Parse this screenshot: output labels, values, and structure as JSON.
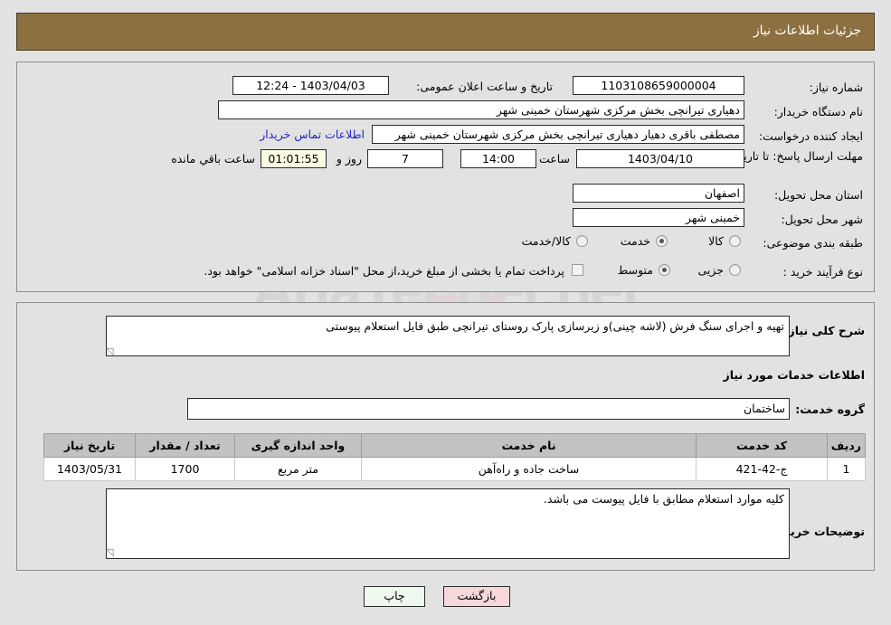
{
  "header": {
    "title": "جزئیات اطلاعات نیاز"
  },
  "watermark": {
    "text": "AriaTender.net"
  },
  "top_panel": {
    "need_number": {
      "label": "شماره نیاز:",
      "value": "1103108659000004"
    },
    "announce_datetime": {
      "label": "تاریخ و ساعت اعلان عمومی:",
      "value": "1403/04/03 - 12:24"
    },
    "buyer_org": {
      "label": "نام دستگاه خریدار:",
      "value": "دهیاری تیرانچی بخش مرکزی شهرستان خمینی شهر"
    },
    "requester": {
      "label": "ایجاد کننده درخواست:",
      "value": "مصطفی باقری دهیار  دهیاری تیرانچی بخش مرکزی شهرستان خمینی شهر"
    },
    "contact_link": "اطلاعات تماس خریدار",
    "deadline": {
      "label": "مهلت ارسال پاسخ: تا تاریخ:",
      "date": "1403/04/10",
      "time_label": "ساعت",
      "time": "14:00",
      "days": "7",
      "days_label": "روز و",
      "countdown": "01:01:55",
      "countdown_label": "ساعت باقي مانده"
    },
    "province": {
      "label": "استان محل تحویل:",
      "value": "اصفهان"
    },
    "city": {
      "label": "شهر محل تحویل:",
      "value": "خمینی شهر"
    },
    "category": {
      "label": "طبقه بندی موضوعی:",
      "options": [
        {
          "label": "کالا",
          "selected": false
        },
        {
          "label": "خدمت",
          "selected": true
        },
        {
          "label": "کالا/خدمت",
          "selected": false
        }
      ]
    },
    "purchase_type": {
      "label": "نوع فرآیند خرید :",
      "options": [
        {
          "label": "جزیی",
          "selected": false
        },
        {
          "label": "متوسط",
          "selected": true
        }
      ]
    },
    "treasury_checkbox": {
      "checked": false,
      "label": "پرداخت تمام یا بخشی از مبلغ خرید،از محل \"اسناد خزانه اسلامی\" خواهد بود."
    }
  },
  "bottom_panel": {
    "general_desc": {
      "label": "شرح کلی نیاز:",
      "value": "تهیه و اجرای سنگ فرش (لاشه چینی)و زیرسازی پارک روستای تیرانچی طبق فایل استعلام پیوستی"
    },
    "services_section_title": "اطلاعات خدمات مورد نیاز",
    "service_group": {
      "label": "گروه خدمت:",
      "value": "ساختمان"
    },
    "table": {
      "headers": [
        "ردیف",
        "کد خدمت",
        "نام خدمت",
        "واحد اندازه گیری",
        "تعداد / مقدار",
        "تاریخ نیاز"
      ],
      "rows": [
        {
          "row": "1",
          "code": "ج-42-421",
          "name": "ساخت جاده و راه‌آهن",
          "unit": "متر مربع",
          "qty": "1700",
          "need_date": "1403/05/31"
        }
      ]
    },
    "buyer_notes": {
      "label": "توضیحات خریدار:",
      "value": "کلیه موارد استعلام مطابق با فایل پیوست می باشد."
    }
  },
  "footer": {
    "print_label": "چاپ",
    "back_label": "بازگشت"
  },
  "colors": {
    "header_brown": "#8d7040",
    "page_bg": "#e2e2e2",
    "link_blue": "#2222cc",
    "countdown_bg": "#fbfbe4",
    "back_btn_bg": "#f6d7da",
    "print_btn_bg": "#eef8ee",
    "table_header_bg": "#c2c2c2"
  }
}
